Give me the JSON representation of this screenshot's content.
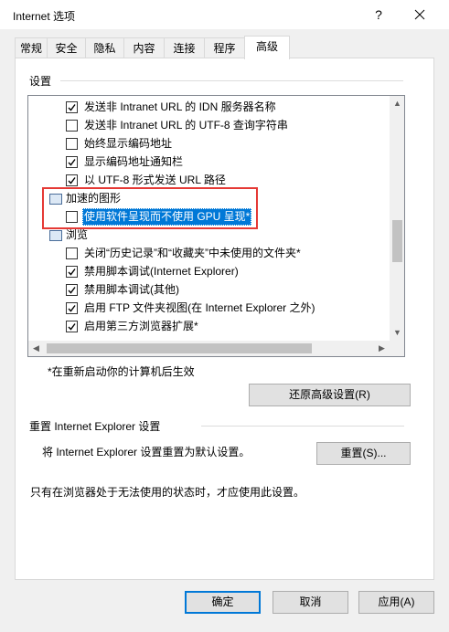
{
  "window": {
    "title": "Internet 选项",
    "help_glyph": "?",
    "close_icon": "close-icon"
  },
  "tabs": [
    "常规",
    "安全",
    "隐私",
    "内容",
    "连接",
    "程序",
    "高级"
  ],
  "active_tab": "高级",
  "settings": {
    "group_label": "设置",
    "items": [
      {
        "label": "发送非 Intranet URL 的 IDN 服务器名称",
        "checked": true
      },
      {
        "label": "发送非 Intranet URL 的 UTF-8 查询字符串",
        "checked": false
      },
      {
        "label": "始终显示编码地址",
        "checked": false
      },
      {
        "label": "显示编码地址通知栏",
        "checked": true
      },
      {
        "label": "以 UTF-8 形式发送 URL 路径",
        "checked": true
      },
      {
        "label": "加速的图形",
        "category": true
      },
      {
        "label": "使用软件呈现而不使用 GPU 呈现*",
        "checked": false,
        "selected": true
      },
      {
        "label": "浏览",
        "category": true
      },
      {
        "label": "关闭“历史记录”和“收藏夹”中未使用的文件夹*",
        "checked": false
      },
      {
        "label": "禁用脚本调试(Internet Explorer)",
        "checked": true
      },
      {
        "label": "禁用脚本调试(其他)",
        "checked": true
      },
      {
        "label": "启用 FTP 文件夹视图(在 Internet Explorer 之外)",
        "checked": true
      },
      {
        "label": "启用第三方浏览器扩展*",
        "checked": true
      }
    ],
    "footnote": "*在重新启动你的计算机后生效",
    "restore_button": "还原高级设置(R)"
  },
  "reset": {
    "group_label": "重置 Internet Explorer 设置",
    "description": "将 Internet Explorer 设置重置为默认设置。",
    "button": "重置(S)...",
    "note": "只有在浏览器处于无法使用的状态时，才应使用此设置。"
  },
  "buttons": {
    "ok": "确定",
    "cancel": "取消",
    "apply": "应用(A)"
  }
}
